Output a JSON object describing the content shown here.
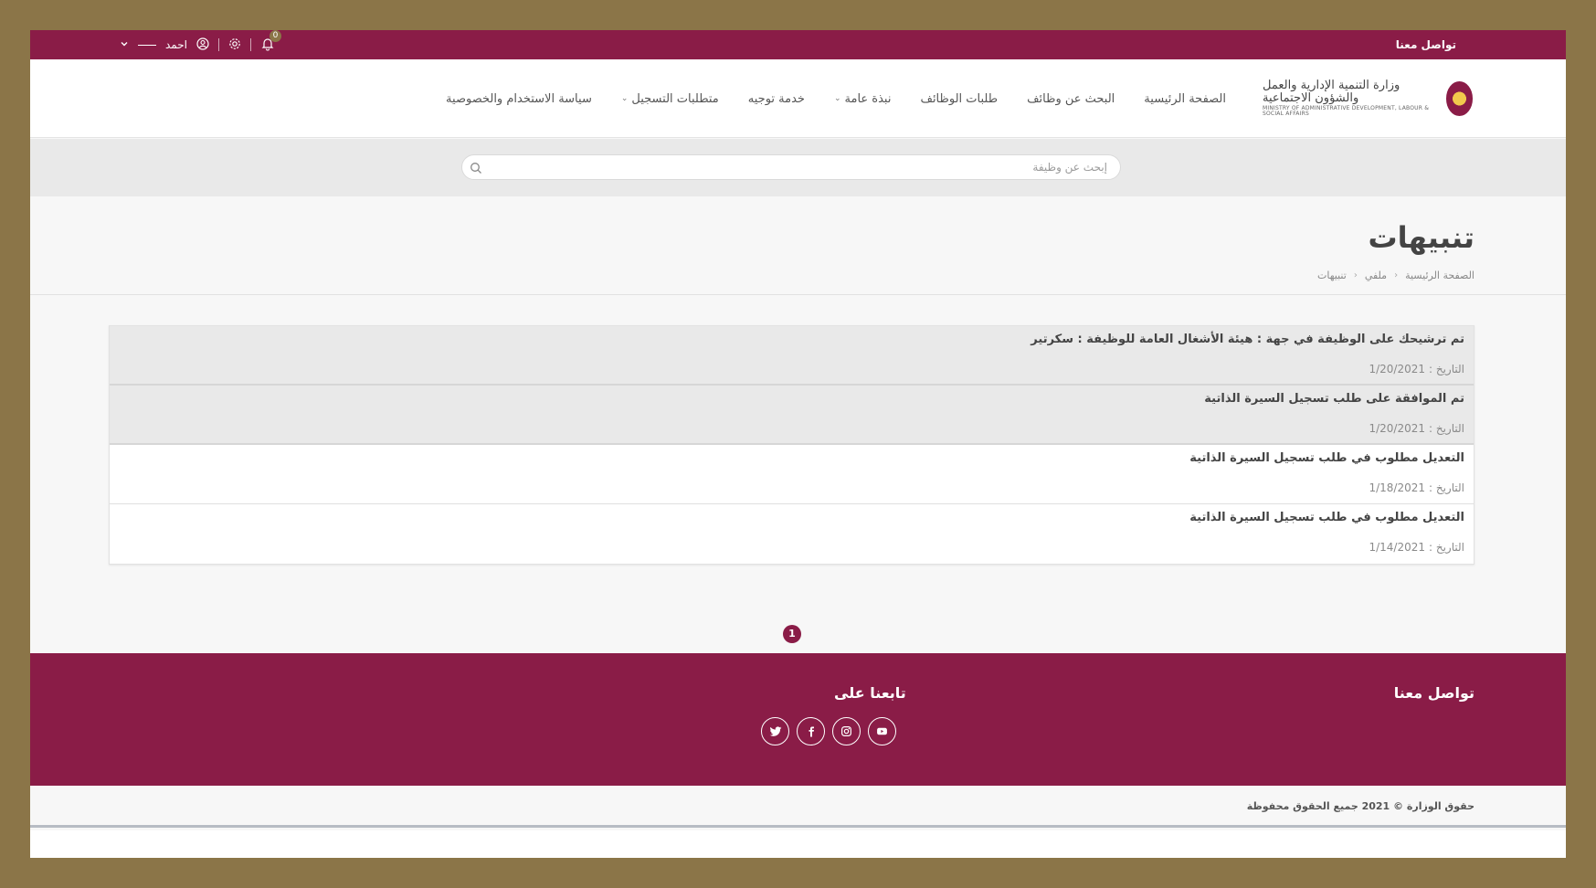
{
  "topbar": {
    "contact_label": "تواصل معنا",
    "user_name": "احمد",
    "notification_count": "0"
  },
  "header": {
    "logo_text_ar": "وزارة التنمية الإدارية والعمل والشؤون الاجتماعية",
    "logo_text_en": "MINISTRY OF ADMINISTRATIVE DEVELOPMENT, LABOUR & SOCIAL AFFAIRS",
    "nav": [
      {
        "label": "الصفحة الرئيسية",
        "dropdown": false
      },
      {
        "label": "البحث عن وظائف",
        "dropdown": false
      },
      {
        "label": "طلبات الوظائف",
        "dropdown": false
      },
      {
        "label": "نبذة عامة",
        "dropdown": true
      },
      {
        "label": "خدمة توجيه",
        "dropdown": false
      },
      {
        "label": "متطلبات التسجيل",
        "dropdown": true
      },
      {
        "label": "سياسة الاستخدام والخصوصية",
        "dropdown": false
      }
    ]
  },
  "search": {
    "placeholder": "إبحث عن وظيفة",
    "value": ""
  },
  "page": {
    "title": "تنبيهات",
    "breadcrumb": [
      "الصفحة الرئيسية",
      "ملفي",
      "تنبيهات"
    ]
  },
  "notifications": {
    "date_label": "التاريخ :",
    "items": [
      {
        "title": "تم ترشيحك على الوظيفة في جهة : هيئة الأشغال العامة للوظيفة : سكرتير",
        "date": "1/20/2021",
        "unread": true
      },
      {
        "title": "تم الموافقة على طلب تسجيل السيرة الذاتية",
        "date": "1/20/2021",
        "unread": true
      },
      {
        "title": "التعديل مطلوب في طلب تسجيل السيرة الذاتية",
        "date": "1/18/2021",
        "unread": false
      },
      {
        "title": "التعديل مطلوب في طلب تسجيل السيرة الذاتية",
        "date": "1/14/2021",
        "unread": false
      }
    ]
  },
  "pagination": {
    "current_page": "1"
  },
  "footer": {
    "contact_heading": "تواصل معنا",
    "follow_heading": "تابعنا على",
    "social": [
      "youtube-icon",
      "instagram-icon",
      "facebook-icon",
      "twitter-icon"
    ],
    "copyright": "حقوق الوزارة © 2021 جميع الحقوق محفوظة"
  },
  "colors": {
    "brand": "#8a1c47",
    "frame": "#8b7548",
    "unread_bg": "#e9e9e9"
  }
}
